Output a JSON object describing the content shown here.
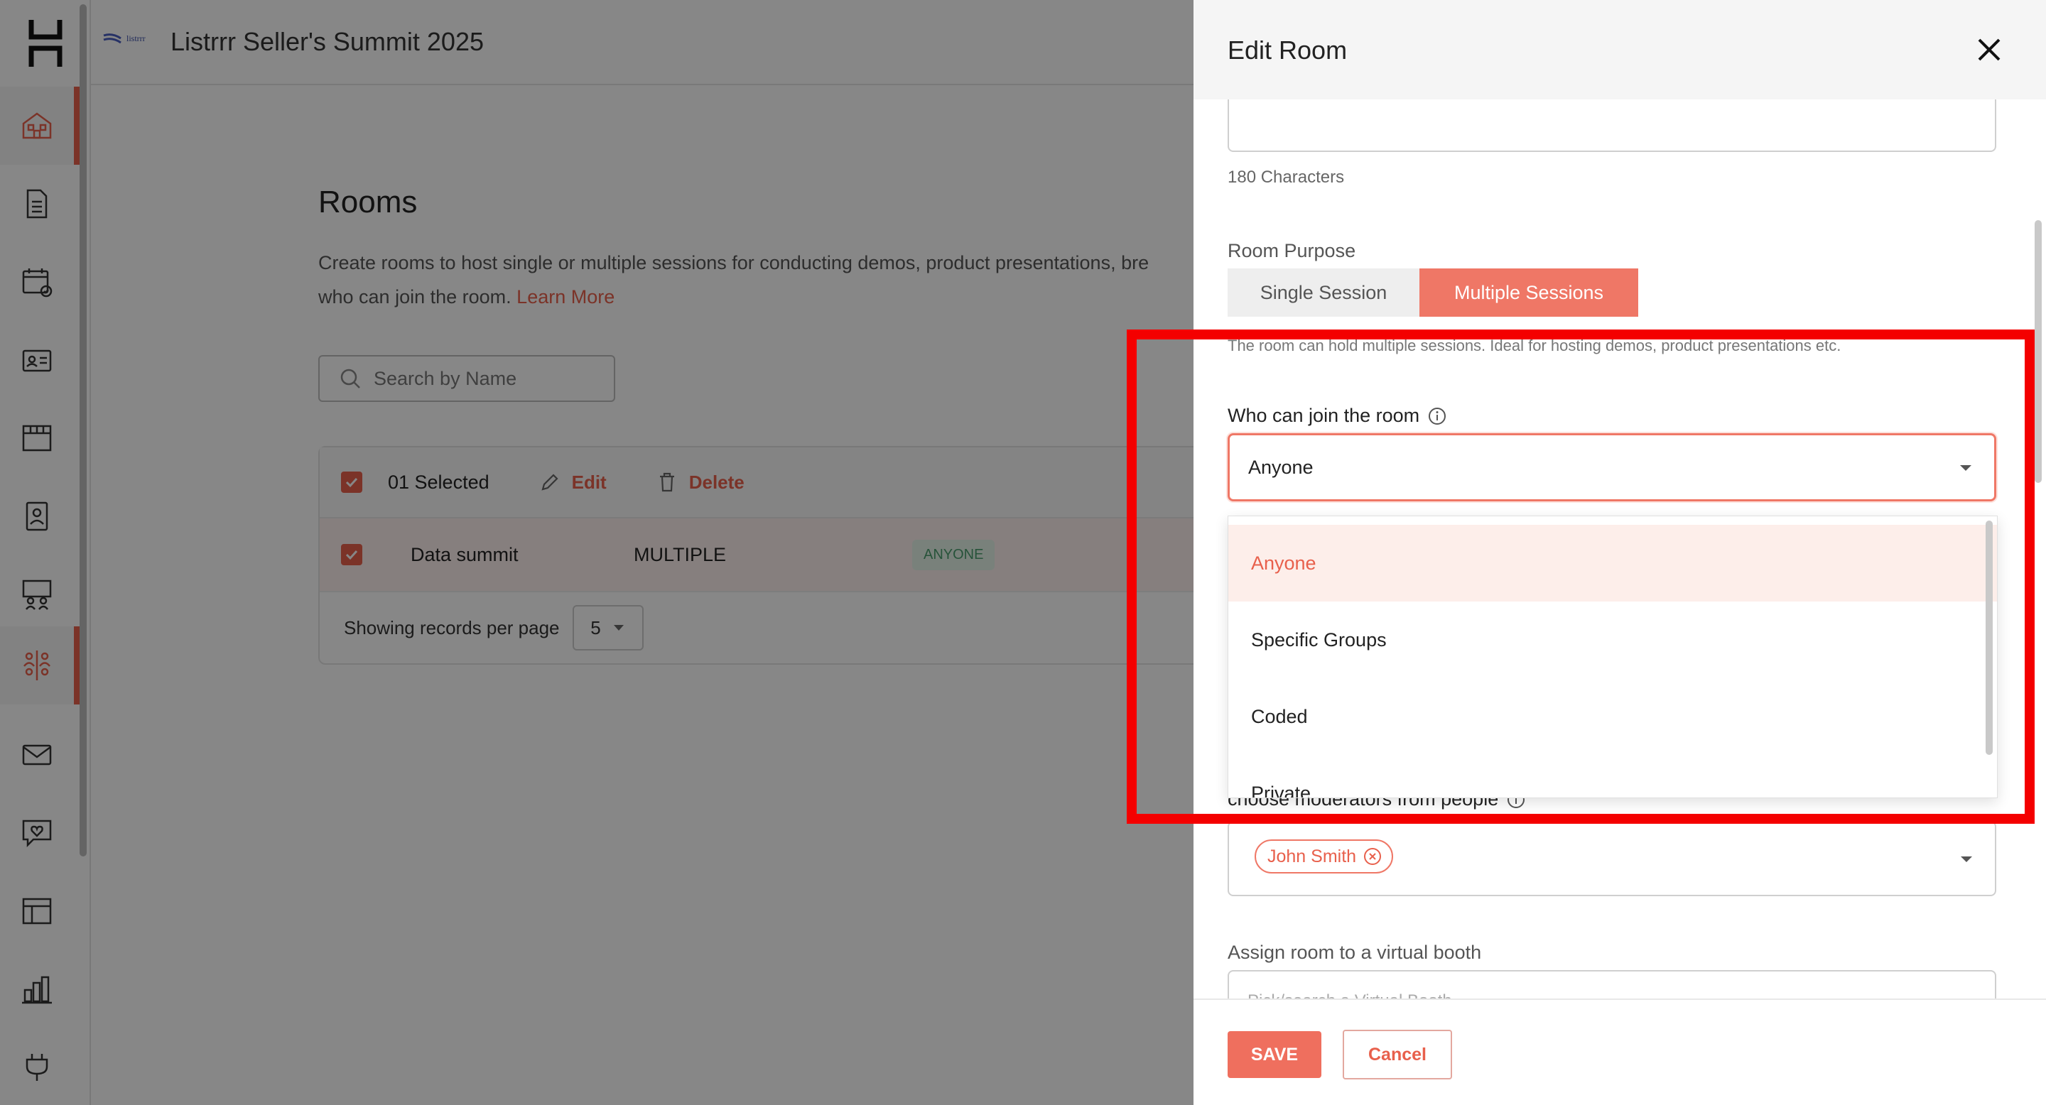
{
  "header": {
    "brand_text": "listrrr",
    "event_title": "Listrrr Seller's Summit 2025"
  },
  "sidebar": {
    "items": [
      {
        "icon": "home-icon",
        "active": true
      },
      {
        "icon": "document-icon"
      },
      {
        "icon": "calendar-icon"
      },
      {
        "icon": "badge-icon"
      },
      {
        "icon": "booth-icon"
      },
      {
        "icon": "id-card-icon"
      },
      {
        "icon": "stage-icon"
      },
      {
        "icon": "rooms-icon",
        "active": true
      },
      {
        "icon": "mail-icon"
      },
      {
        "icon": "chat-heart-icon"
      },
      {
        "icon": "layout-icon"
      },
      {
        "icon": "analytics-icon"
      },
      {
        "icon": "plug-icon"
      }
    ]
  },
  "page": {
    "title": "Rooms",
    "description": "Create rooms to host single or multiple sessions for conducting demos, product presentations, bre",
    "description_line2": "who can join the room.",
    "learn_more": "Learn More",
    "search_placeholder": "Search by Name"
  },
  "table": {
    "selected_label": "01 Selected",
    "edit_label": "Edit",
    "delete_label": "Delete",
    "rows": [
      {
        "name": "Data summit",
        "type": "MULTIPLE",
        "access": "ANYONE"
      }
    ],
    "pager_label": "Showing records per page",
    "per_page": "5"
  },
  "panel": {
    "title": "Edit Room",
    "chars_left": "180 Characters",
    "purpose_label": "Room Purpose",
    "purpose_options": [
      "Single Session",
      "Multiple Sessions"
    ],
    "purpose_selected": "Multiple Sessions",
    "purpose_helper": "The room can hold multiple sessions. Ideal for hosting demos, product presentations etc.",
    "who_label": "Who can join the room",
    "who_value": "Anyone",
    "who_options": [
      "Anyone",
      "Specific Groups",
      "Coded",
      "Private"
    ],
    "moderators_label": "choose moderators from people",
    "moderators": [
      "John Smith"
    ],
    "booth_label": "Assign room to a virtual booth",
    "booth_placeholder": "Pick/search a Virtual Booth",
    "save_label": "SAVE",
    "cancel_label": "Cancel"
  },
  "colors": {
    "accent": "#e8604c",
    "accent_light": "#ef7766",
    "highlight": "#f40000",
    "overlay": "rgba(0,0,0,0.47)"
  }
}
